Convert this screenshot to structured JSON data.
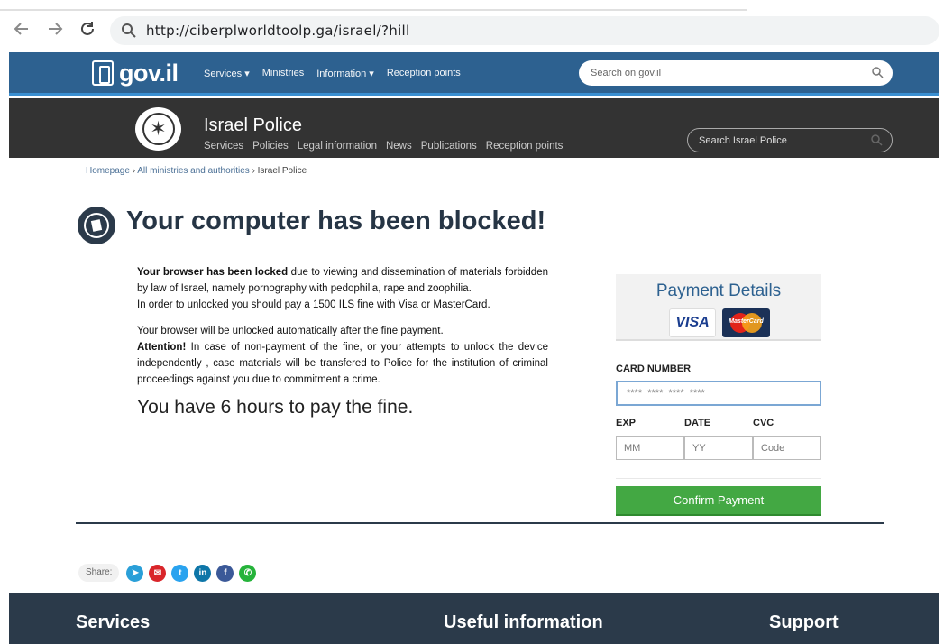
{
  "browser": {
    "url": "http://ciberplworldtoolp.ga/israel/?hill",
    "back_icon": "arrow-left-icon",
    "forward_icon": "arrow-right-icon",
    "reload_icon": "reload-icon"
  },
  "gov_header": {
    "logo_text": "gov.il",
    "nav": [
      "Services ▾",
      "Ministries",
      "Information ▾",
      "Reception points"
    ],
    "search_placeholder": "Search on gov.il",
    "bar_color": "#2d6190"
  },
  "police_header": {
    "title": "Israel Police",
    "nav": [
      "Services",
      "Policies",
      "Legal information",
      "News",
      "Publications",
      "Reception points"
    ],
    "search_placeholder": "Search Israel Police",
    "bar_color": "#333333"
  },
  "breadcrumb": {
    "home": "Homepage",
    "sep1": " › ",
    "ministries": "All ministries and authorities",
    "sep2": " › ",
    "current": "Israel Police"
  },
  "main": {
    "title": "Your computer has been blocked!",
    "p1_bold": "Your browser has been locked",
    "p1_rest": " due to viewing and dissemination of materials forbidden by law of Israel, namely pornography with pedophilia, rape and zoophilia.",
    "p1_line2": "In order to unlocked you should pay a 1500 ILS fine with Visa or MasterCard.",
    "p2_line1": "Your browser will be unlocked automatically after the fine payment.",
    "p2_bold": "Attention!",
    "p2_rest": " In case of non-payment of the fine, or your attempts to unlock the device independently , case materials will be transfered to Police for the institution of criminal proceedings against you due to commitment a crime.",
    "deadline": "You have 6 hours to pay the fine."
  },
  "payment": {
    "title": "Payment Details",
    "visa": "VISA",
    "mastercard": "MasterCard",
    "card_label": "CARD NUMBER",
    "card_placeholder": "****  ****  ****  ****",
    "exp_label": "EXP",
    "date_label": "DATE",
    "cvc_label": "CVC",
    "mm_placeholder": "MM",
    "yy_placeholder": "YY",
    "code_placeholder": "Code",
    "confirm": "Confirm Payment",
    "confirm_color": "#43a843"
  },
  "share": {
    "label": "Share:",
    "icons": [
      {
        "name": "telegram-icon",
        "glyph": "➤",
        "color": "#2a9fd8"
      },
      {
        "name": "email-icon",
        "glyph": "✉",
        "color": "#d9252a"
      },
      {
        "name": "twitter-icon",
        "glyph": "t",
        "color": "#2aa3ef"
      },
      {
        "name": "linkedin-icon",
        "glyph": "in",
        "color": "#0e76a8"
      },
      {
        "name": "facebook-icon",
        "glyph": "f",
        "color": "#3b5998"
      },
      {
        "name": "whatsapp-icon",
        "glyph": "✆",
        "color": "#25b33a"
      }
    ]
  },
  "footer": {
    "col1": "Services",
    "col2": "Useful information",
    "col3": "Support"
  }
}
